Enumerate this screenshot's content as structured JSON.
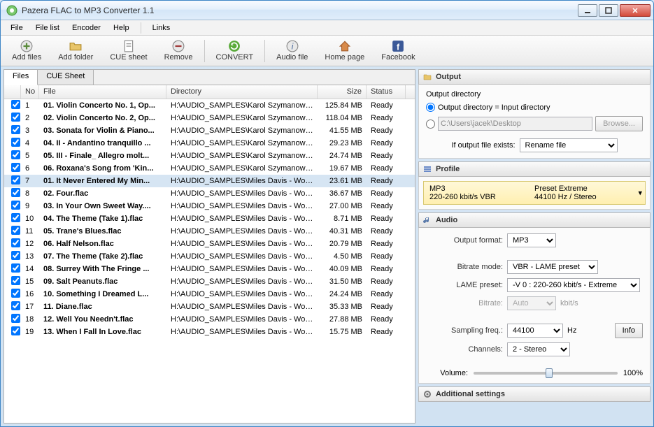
{
  "window": {
    "title": "Pazera FLAC to MP3 Converter 1.1"
  },
  "menu": {
    "file": "File",
    "filelist": "File list",
    "encoder": "Encoder",
    "help": "Help",
    "links": "Links"
  },
  "toolbar": {
    "addfiles": "Add files",
    "addfolder": "Add folder",
    "cuesheet": "CUE sheet",
    "remove": "Remove",
    "convert": "CONVERT",
    "audiofile": "Audio file",
    "homepage": "Home page",
    "facebook": "Facebook"
  },
  "tabs": {
    "files": "Files",
    "cue": "CUE Sheet"
  },
  "columns": {
    "no": "No",
    "file": "File",
    "dir": "Directory",
    "size": "Size",
    "status": "Status"
  },
  "files": [
    {
      "no": "1",
      "name": "01. Violin Concerto No. 1, Op...",
      "dir": "H:\\AUDIO_SAMPLES\\Karol Szymanowski...",
      "size": "125.84 MB",
      "status": "Ready"
    },
    {
      "no": "2",
      "name": "02. Violin Concerto No. 2, Op...",
      "dir": "H:\\AUDIO_SAMPLES\\Karol Szymanowski...",
      "size": "118.04 MB",
      "status": "Ready"
    },
    {
      "no": "3",
      "name": "03. Sonata for Violin & Piano...",
      "dir": "H:\\AUDIO_SAMPLES\\Karol Szymanowski...",
      "size": "41.55 MB",
      "status": "Ready"
    },
    {
      "no": "4",
      "name": "04. II - Andantino tranquillo ...",
      "dir": "H:\\AUDIO_SAMPLES\\Karol Szymanowski...",
      "size": "29.23 MB",
      "status": "Ready"
    },
    {
      "no": "5",
      "name": "05. III - Finale_ Allegro molt...",
      "dir": "H:\\AUDIO_SAMPLES\\Karol Szymanowski...",
      "size": "24.74 MB",
      "status": "Ready"
    },
    {
      "no": "6",
      "name": "06. Roxana's Song from 'Kin...",
      "dir": "H:\\AUDIO_SAMPLES\\Karol Szymanowski...",
      "size": "19.67 MB",
      "status": "Ready"
    },
    {
      "no": "7",
      "name": "01. It Never Entered My Min...",
      "dir": "H:\\AUDIO_SAMPLES\\Miles Davis - Worki...",
      "size": "23.61 MB",
      "status": "Ready"
    },
    {
      "no": "8",
      "name": "02. Four.flac",
      "dir": "H:\\AUDIO_SAMPLES\\Miles Davis - Worki...",
      "size": "36.67 MB",
      "status": "Ready"
    },
    {
      "no": "9",
      "name": "03. In Your Own Sweet Way....",
      "dir": "H:\\AUDIO_SAMPLES\\Miles Davis - Worki...",
      "size": "27.00 MB",
      "status": "Ready"
    },
    {
      "no": "10",
      "name": "04. The Theme (Take 1).flac",
      "dir": "H:\\AUDIO_SAMPLES\\Miles Davis - Worki...",
      "size": "8.71 MB",
      "status": "Ready"
    },
    {
      "no": "11",
      "name": "05. Trane's Blues.flac",
      "dir": "H:\\AUDIO_SAMPLES\\Miles Davis - Worki...",
      "size": "40.31 MB",
      "status": "Ready"
    },
    {
      "no": "12",
      "name": "06. Half Nelson.flac",
      "dir": "H:\\AUDIO_SAMPLES\\Miles Davis - Worki...",
      "size": "20.79 MB",
      "status": "Ready"
    },
    {
      "no": "13",
      "name": "07. The Theme (Take 2).flac",
      "dir": "H:\\AUDIO_SAMPLES\\Miles Davis - Worki...",
      "size": "4.50 MB",
      "status": "Ready"
    },
    {
      "no": "14",
      "name": "08. Surrey With The Fringe ...",
      "dir": "H:\\AUDIO_SAMPLES\\Miles Davis - Worki...",
      "size": "40.09 MB",
      "status": "Ready"
    },
    {
      "no": "15",
      "name": "09. Salt Peanuts.flac",
      "dir": "H:\\AUDIO_SAMPLES\\Miles Davis - Worki...",
      "size": "31.50 MB",
      "status": "Ready"
    },
    {
      "no": "16",
      "name": "10. Something I Dreamed L...",
      "dir": "H:\\AUDIO_SAMPLES\\Miles Davis - Worki...",
      "size": "24.24 MB",
      "status": "Ready"
    },
    {
      "no": "17",
      "name": "11. Diane.flac",
      "dir": "H:\\AUDIO_SAMPLES\\Miles Davis - Worki...",
      "size": "35.33 MB",
      "status": "Ready"
    },
    {
      "no": "18",
      "name": "12. Well You Needn't.flac",
      "dir": "H:\\AUDIO_SAMPLES\\Miles Davis - Worki...",
      "size": "27.88 MB",
      "status": "Ready"
    },
    {
      "no": "19",
      "name": "13. When I Fall In Love.flac",
      "dir": "H:\\AUDIO_SAMPLES\\Miles Davis - Worki...",
      "size": "15.75 MB",
      "status": "Ready"
    }
  ],
  "selected_index": 6,
  "output": {
    "header": "Output",
    "label_dir": "Output directory",
    "opt_same": "Output directory = Input directory",
    "path_value": "C:\\Users\\jacek\\Desktop",
    "browse": "Browse...",
    "exists_label": "If output file exists:",
    "exists_value": "Rename file"
  },
  "profile": {
    "header": "Profile",
    "format": "MP3",
    "bitrate": "220-260 kbit/s VBR",
    "preset": "Preset Extreme",
    "rate": "44100 Hz / Stereo"
  },
  "audio": {
    "header": "Audio",
    "output_format_label": "Output format:",
    "output_format": "MP3",
    "bitrate_mode_label": "Bitrate mode:",
    "bitrate_mode": "VBR - LAME preset",
    "lame_preset_label": "LAME preset:",
    "lame_preset": "-V 0 : 220-260 kbit/s - Extreme",
    "bitrate_label": "Bitrate:",
    "bitrate_value": "Auto",
    "bitrate_unit": "kbit/s",
    "sampling_label": "Sampling freq.:",
    "sampling": "44100",
    "hz": "Hz",
    "channels_label": "Channels:",
    "channels": "2 - Stereo",
    "info": "Info",
    "volume_label": "Volume:",
    "volume_value": "100%"
  },
  "additional": {
    "header": "Additional settings"
  }
}
